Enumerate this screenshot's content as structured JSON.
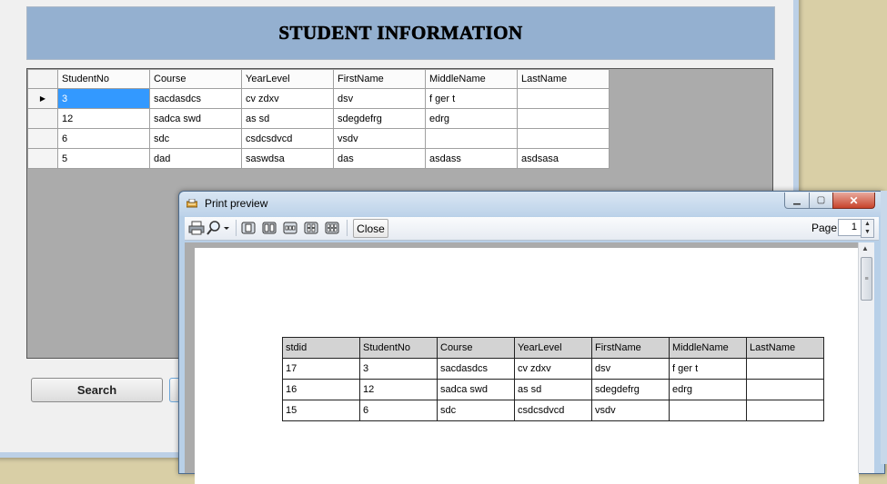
{
  "main_window": {
    "header_title": "STUDENT INFORMATION",
    "grid": {
      "columns": [
        "StudentNo",
        "Course",
        "YearLevel",
        "FirstName",
        "MiddleName",
        "LastName"
      ],
      "rows": [
        [
          "3",
          "sacdasdcs",
          "cv zdxv",
          "dsv",
          "f ger t",
          ""
        ],
        [
          "12",
          "sadca swd",
          "as sd",
          "sdegdefrg",
          "edrg",
          ""
        ],
        [
          "6",
          "sdc",
          "csdcsdvcd",
          "vsdv",
          "",
          ""
        ],
        [
          "5",
          "dad",
          "saswdsa",
          "das",
          "asdass",
          "asdsasa"
        ]
      ],
      "current_row_marker": "▶"
    },
    "search_button": "Search"
  },
  "preview_window": {
    "title": "Print preview",
    "close_button": "Close",
    "page_label": "Page",
    "page_value": "1",
    "table": {
      "columns": [
        "stdid",
        "StudentNo",
        "Course",
        "YearLevel",
        "FirstName",
        "MiddleName",
        "LastName"
      ],
      "rows": [
        [
          "17",
          "3",
          "sacdasdcs",
          "cv zdxv",
          "dsv",
          "f ger t",
          ""
        ],
        [
          "16",
          "12",
          "sadca swd",
          "as sd",
          "sdegdefrg",
          "edrg",
          ""
        ],
        [
          "15",
          "6",
          "sdc",
          "csdcsdvcd",
          "vsdv",
          "",
          ""
        ]
      ]
    },
    "toolbar_icons": [
      "print-icon",
      "zoom-icon",
      "one-page-icon",
      "two-pages-icon",
      "three-pages-icon",
      "four-pages-icon",
      "six-pages-icon"
    ]
  }
}
